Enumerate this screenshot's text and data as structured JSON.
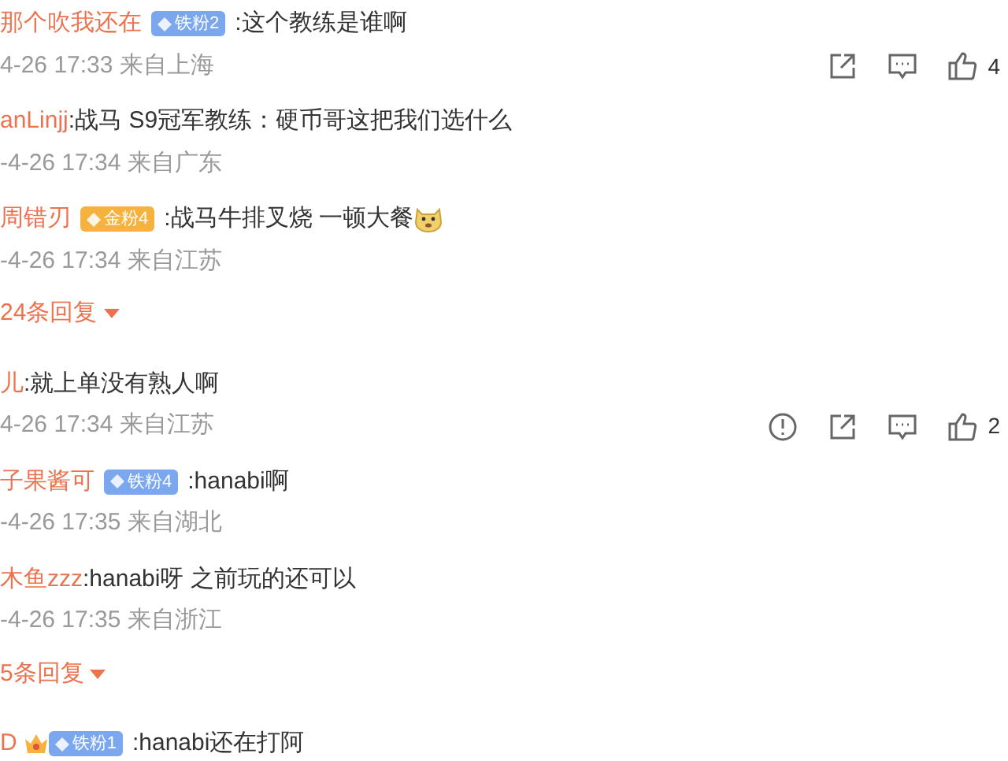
{
  "items": [
    {
      "kind": "comment",
      "user": "那个吹我还在",
      "badge": {
        "kind": "iron",
        "label": "铁粉2"
      },
      "text": ":这个教练是谁啊",
      "meta": "4-26 17:33 来自上海",
      "actions": true,
      "report": false,
      "likes": "4"
    },
    {
      "kind": "comment",
      "user": "anLinjj",
      "text": ":战马 S9冠军教练：硬币哥这把我们选什么",
      "meta": "-4-26 17:34 来自广东"
    },
    {
      "kind": "comment",
      "user": "周错刃",
      "badge": {
        "kind": "gold",
        "label": "金粉4"
      },
      "text": ":战马牛排叉烧 一顿大餐",
      "emoji": true,
      "meta": "-4-26 17:34 来自江苏"
    },
    {
      "kind": "more",
      "label": "24条回复"
    },
    {
      "kind": "comment",
      "user": "儿",
      "text": ":就上单没有熟人啊",
      "meta": "4-26 17:34 来自江苏",
      "actions": true,
      "report": true,
      "likes": "2"
    },
    {
      "kind": "comment",
      "user": "子果酱可",
      "badge": {
        "kind": "iron",
        "label": "铁粉4"
      },
      "text": ":hanabi啊",
      "meta": "-4-26 17:35 来自湖北"
    },
    {
      "kind": "comment",
      "user": "木鱼zzz",
      "text": ":hanabi呀 之前玩的还可以",
      "meta": "-4-26 17:35 来自浙江"
    },
    {
      "kind": "more",
      "label": "5条回复"
    },
    {
      "kind": "comment",
      "user": "D",
      "crown": true,
      "badge": {
        "kind": "iron",
        "label": "铁粉1"
      },
      "text": ":hanabi还在打阿"
    }
  ]
}
